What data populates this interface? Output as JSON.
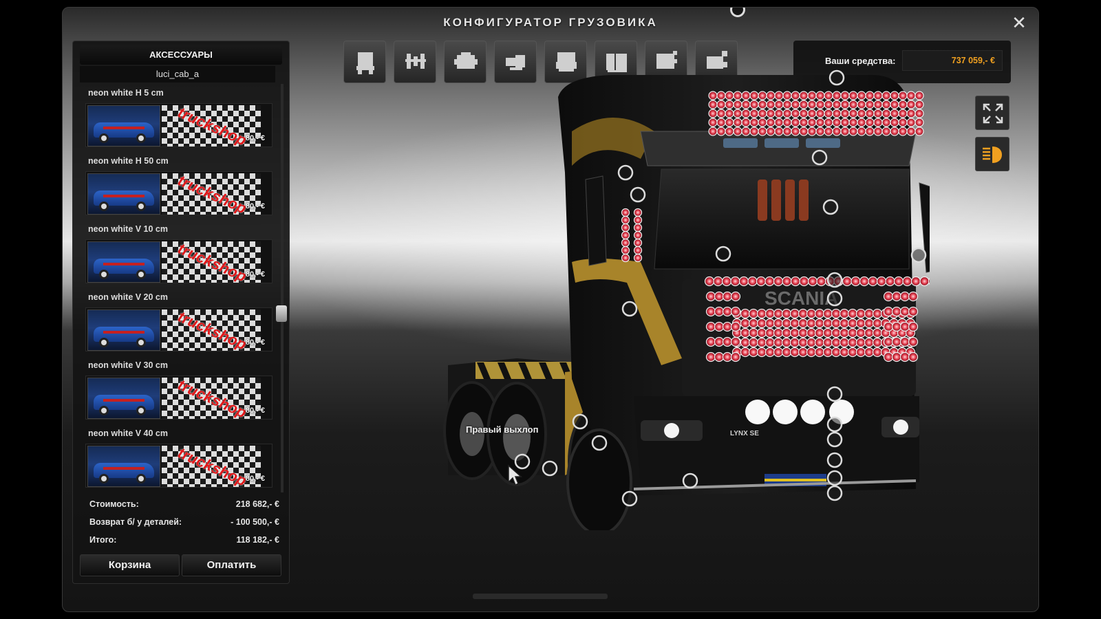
{
  "window": {
    "title": "КОНФИГУРАТОР ГРУЗОВИКА",
    "close_glyph": "✕"
  },
  "panel": {
    "header": "АКСЕССУАРЫ",
    "subheader": "luci_cab_a",
    "items": [
      {
        "name": "neon white H 5 cm",
        "price": "80,- €"
      },
      {
        "name": "neon white H 50 cm",
        "price": "80,- €"
      },
      {
        "name": "neon white V 10 cm",
        "price": "80,- €"
      },
      {
        "name": "neon white V 20 cm",
        "price": "80,- €"
      },
      {
        "name": "neon white V 30 cm",
        "price": "80,- €"
      },
      {
        "name": "neon white V 40 cm",
        "price": "80,- €"
      }
    ],
    "thumb_brand_text": "truckshop",
    "totals": {
      "cost_label": "Стоимость:",
      "cost_value": "218 682,- €",
      "refund_label": "Возврат б/ у деталей:",
      "refund_value": "- 100 500,- €",
      "total_label": "Итого:",
      "total_value": "118 182,- €"
    },
    "cart_button": "Корзина",
    "pay_button": "Оплатить"
  },
  "toolbar": {
    "categories": [
      {
        "icon": "truck-cab-icon"
      },
      {
        "icon": "chassis-icon"
      },
      {
        "icon": "engine-icon"
      },
      {
        "icon": "transmission-icon"
      },
      {
        "icon": "cabin-interior-icon"
      },
      {
        "icon": "cabin-exterior-icon"
      },
      {
        "icon": "accessories-icon"
      },
      {
        "icon": "paint-icon"
      }
    ]
  },
  "funds": {
    "label": "Ваши средства:",
    "value": "737 059,- €"
  },
  "viewport": {
    "hint": "Правый выхлоп",
    "plate_text": "LYNX SE",
    "brand_text": "SCANIA"
  },
  "colors": {
    "funds_accent": "#f0a020",
    "neon_red": "#e23a4a",
    "truck_gold": "#a8842a"
  }
}
